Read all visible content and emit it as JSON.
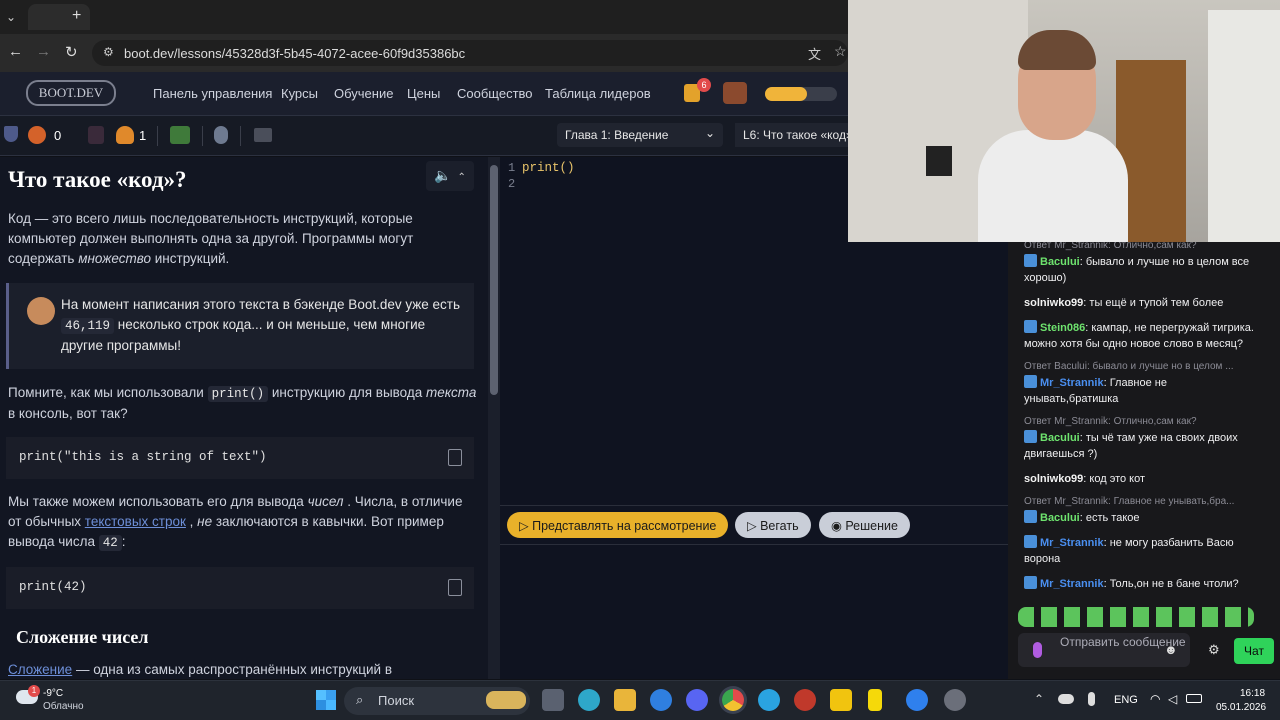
{
  "browser": {
    "url": "boot.dev/lessons/45328d3f-5b45-4072-acee-60f9d35386bc",
    "new_tab": "+"
  },
  "site": {
    "logo": "BOOT.DEV",
    "nav": [
      "Панель управления",
      "Курсы",
      "Обучение",
      "Цены",
      "Сообщество",
      "Таблица лидеров"
    ],
    "notif_count": "6",
    "stats": {
      "gems": "0",
      "flames": "1"
    },
    "chapter": "Глава 1: Введение",
    "lesson": "L6: Что такое «код»?"
  },
  "lesson": {
    "title": "Что такое «код»?",
    "p1a": "Код — это всего лишь последовательность инструкций, которые компьютер должен выполнять одна за другой. Программы могут содержать ",
    "p1b": "множество",
    "p1c": " инструкций.",
    "quote_a": "На момент написания этого текста в бэкенде Boot.dev уже есть ",
    "quote_num": "46,119",
    "quote_b": " несколько строк кода... и он меньше, чем многие другие программы!",
    "p2a": "Помните, как мы использовали ",
    "p2code": "print()",
    "p2b": " инструкцию для вывода ",
    "p2em": "текста",
    "p2c": " в консоль, вот так?",
    "code1": "print(\"this is a string of text\")",
    "p3a": "Мы также можем использовать его для вывода ",
    "p3em": "чисел",
    "p3b": " . Числа, в отличие от обычных ",
    "p3link": "текстовых строк",
    "p3c": " , ",
    "p3em2": "не",
    "p3d": " заключаются в кавычки. Вот пример вывода числа ",
    "p3code": "42",
    "p3e": ":",
    "code2": "print(42)",
    "h2": "Сложение чисел",
    "p4link": "Сложение",
    "p4": " — одна из самых распространённых инструкций в"
  },
  "editor": {
    "line1": "1",
    "line2": "2",
    "code": "print()"
  },
  "buttons": {
    "submit": "Представлять на рассмотрение",
    "run": "Вегать",
    "solution": "Решение"
  },
  "chat": {
    "messages": [
      {
        "reply": "Ответ Mr_Strannik: Отлично,сам как?",
        "user": "Bacului",
        "text": ": бывало и лучше но в целом все хорошо)",
        "color": "#6ee36e"
      },
      {
        "user": "solniwko99",
        "text": ": ты ещё и тупой тем более",
        "color": "#f2f2f2"
      },
      {
        "user": "Stein086",
        "text": ": кампар, не перегружай тигрика. можно хотя бы одно новое слово в месяц?",
        "color": "#6ee36e"
      },
      {
        "reply": "Ответ Bacului: бывало и лучше но в целом ...",
        "user": "Mr_Strannik",
        "text": ": Главное не унывать,братишка",
        "color": "#4a8ff0"
      },
      {
        "reply": "Ответ Mr_Strannik: Отлично,сам как?",
        "user": "Bacului",
        "text": ": ты чё там уже на своих двоих двигаешься ?)",
        "color": "#6ee36e"
      },
      {
        "user": "solniwko99",
        "text": ": код это кот",
        "color": "#f2f2f2"
      },
      {
        "reply": "Ответ Mr_Strannik: Главное не унывать,бра...",
        "user": "Bacului",
        "text": ": есть такое",
        "color": "#6ee36e"
      },
      {
        "user": "Mr_Strannik",
        "text": ": не могу разбанить Васю ворона",
        "color": "#4a8ff0"
      },
      {
        "user": "Mr_Strannik",
        "text": ": Толь,он не в бане чтоли?",
        "color": "#4a8ff0"
      }
    ],
    "input_placeholder": "Отправить сообщение",
    "send": "Чат"
  },
  "taskbar": {
    "weather_temp": "-9°C",
    "weather_desc": "Облачно",
    "search": "Поиск",
    "lang": "ENG",
    "time": "16:18",
    "date": "05.01.2026",
    "weather_badge": "1"
  }
}
